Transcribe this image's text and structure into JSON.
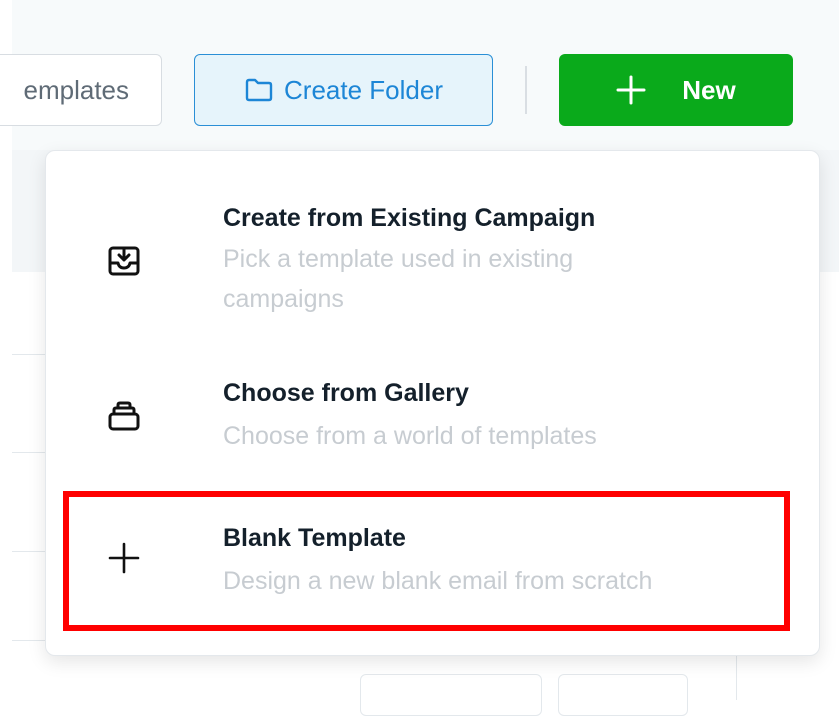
{
  "toolbar": {
    "templates_label": "emplates",
    "create_folder_label": "Create Folder",
    "new_label": "New"
  },
  "dropdown": {
    "items": [
      {
        "icon": "inbox-download-icon",
        "title": "Create from Existing Campaign",
        "description": "Pick a template used in existing campaigns"
      },
      {
        "icon": "gallery-stack-icon",
        "title": "Choose from Gallery",
        "description": "Choose from a world of templates"
      },
      {
        "icon": "plus-icon",
        "title": "Blank Template",
        "description": "Design a new blank email from scratch",
        "highlighted": true
      }
    ]
  },
  "colors": {
    "accent_blue": "#1d86d6",
    "new_button_green": "#0aaa1b",
    "highlight_red": "#ff0000"
  }
}
